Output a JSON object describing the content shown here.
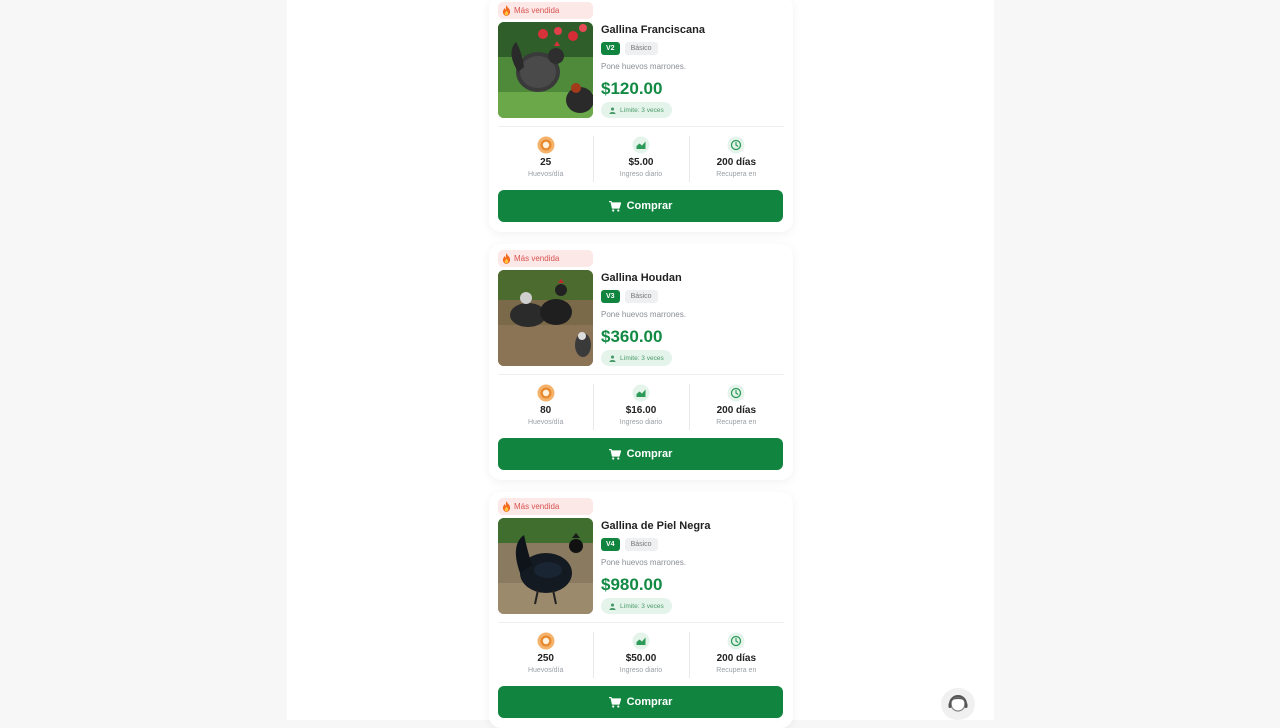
{
  "products": [
    {
      "badge": "Más vendida",
      "name": "Gallina Franciscana",
      "version": "V2",
      "tier": "Básico",
      "description": "Pone huevos marrones.",
      "price": "$120.00",
      "limit": "Límite: 3 veces",
      "eggs_value": "25",
      "eggs_label": "Huevos/día",
      "income_value": "$5.00",
      "income_label": "Ingreso diario",
      "recover_value": "200 días",
      "recover_label": "Recupera en",
      "buy_label": "Comprar"
    },
    {
      "badge": "Más vendida",
      "name": "Gallina Houdan",
      "version": "V3",
      "tier": "Básico",
      "description": "Pone huevos marrones.",
      "price": "$360.00",
      "limit": "Límite: 3 veces",
      "eggs_value": "80",
      "eggs_label": "Huevos/día",
      "income_value": "$16.00",
      "income_label": "Ingreso diario",
      "recover_value": "200 días",
      "recover_label": "Recupera en",
      "buy_label": "Comprar"
    },
    {
      "badge": "Más vendida",
      "name": "Gallina de Piel Negra",
      "version": "V4",
      "tier": "Básico",
      "description": "Pone huevos marrones.",
      "price": "$980.00",
      "limit": "Límite: 3 veces",
      "eggs_value": "250",
      "eggs_label": "Huevos/día",
      "income_value": "$50.00",
      "income_label": "Ingreso diario",
      "recover_value": "200 días",
      "recover_label": "Recupera en",
      "buy_label": "Comprar"
    }
  ],
  "colors": {
    "brand_green": "#11843f",
    "price_green": "#138a44",
    "badge_bg": "#fde8e8",
    "badge_text": "#d9534f"
  },
  "icons": {
    "badge": "fire-icon",
    "limit": "person-icon",
    "eggs": "egg-icon",
    "income": "chart-icon",
    "recover": "clock-icon",
    "buy": "cart-icon",
    "support": "support-agent-icon"
  }
}
